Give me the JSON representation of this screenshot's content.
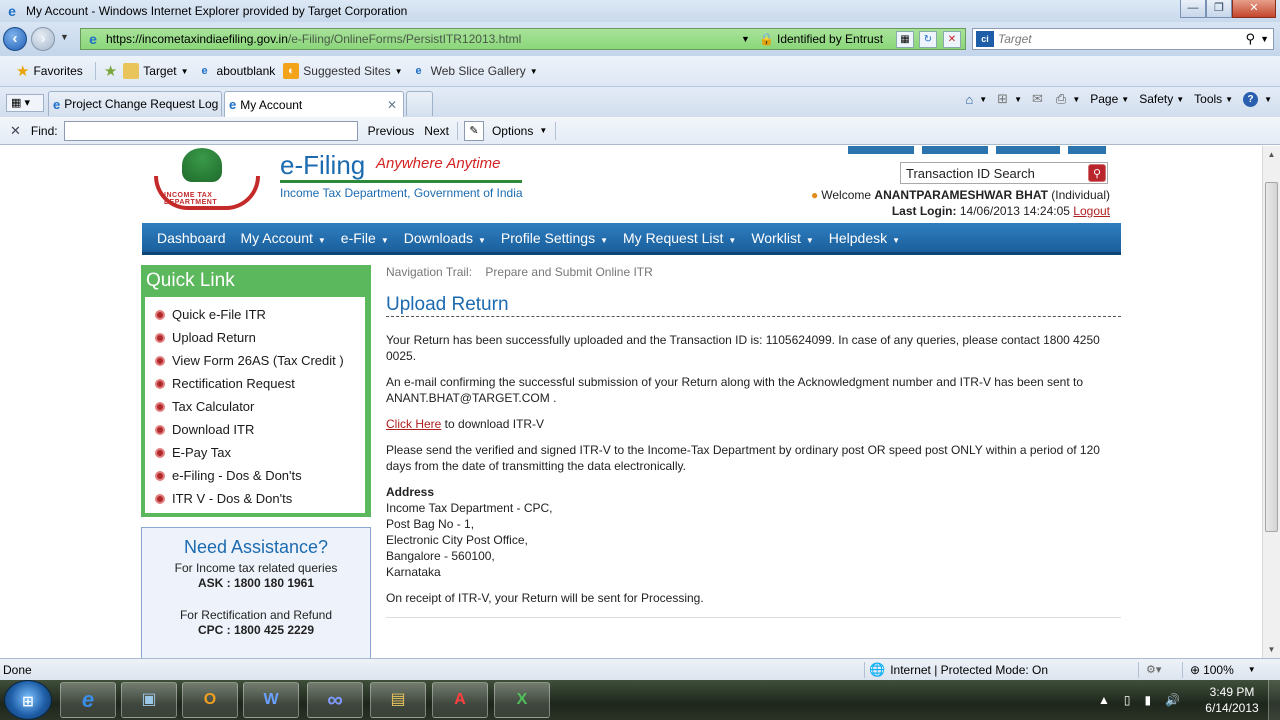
{
  "window": {
    "title": "My Account - Windows Internet Explorer provided by Target Corporation",
    "minimize": "—",
    "restore": "❐",
    "close": "✕"
  },
  "addressbar": {
    "url_host": "https://incometaxindiaefiling.gov.in",
    "url_path": "/e-Filing/OnlineForms/PersistITR12013.html",
    "identity": "Identified by Entrust",
    "search_placeholder": "Target",
    "search_provider_icon": "ci"
  },
  "favorites": {
    "label": "Favorites",
    "items": [
      {
        "label": "Target",
        "icon": "folder-icon",
        "has_menu": true
      },
      {
        "label": "aboutblank",
        "icon": "ie-page-icon",
        "has_menu": false
      },
      {
        "label": "Suggested Sites",
        "icon": "suggested-sites-icon",
        "has_menu": true
      },
      {
        "label": "Web Slice Gallery",
        "icon": "ie-page-icon",
        "has_menu": true
      }
    ]
  },
  "tabs": [
    {
      "label": "Project Change Request Log",
      "active": false
    },
    {
      "label": "My Account",
      "active": true
    }
  ],
  "commandbar": {
    "page": "Page",
    "safety": "Safety",
    "tools": "Tools"
  },
  "findbar": {
    "label": "Find:",
    "value": "",
    "previous": "Previous",
    "next": "Next",
    "options": "Options"
  },
  "site": {
    "brand": "e-Filing",
    "tagline": "Anywhere Anytime",
    "department": "Income Tax Department, Government of India",
    "emblem_text": "INCOME TAX DEPARTMENT",
    "tid_search_placeholder": "Transaction ID Search",
    "welcome_prefix": "Welcome",
    "user_name": "ANANTPARAMESHWAR BHAT",
    "user_type": "(Individual)",
    "last_login_label": "Last Login:",
    "last_login_value": "14/06/2013 14:24:05",
    "logout": "Logout"
  },
  "mainnav": {
    "items": [
      {
        "label": "Dashboard",
        "has_menu": false
      },
      {
        "label": "My Account",
        "has_menu": true
      },
      {
        "label": "e-File",
        "has_menu": true
      },
      {
        "label": "Downloads",
        "has_menu": true
      },
      {
        "label": "Profile Settings",
        "has_menu": true
      },
      {
        "label": "My Request List",
        "has_menu": true
      },
      {
        "label": "Worklist",
        "has_menu": true
      },
      {
        "label": "Helpdesk",
        "has_menu": true
      }
    ]
  },
  "quicklink": {
    "title": "Quick Link",
    "items": [
      "Quick e-File ITR",
      "Upload Return",
      "View Form 26AS (Tax Credit )",
      "Rectification Request",
      "Tax Calculator",
      "Download ITR",
      "E-Pay Tax",
      "e-Filing - Dos & Don'ts",
      "ITR V - Dos & Don'ts"
    ]
  },
  "assistance": {
    "title": "Need Assistance?",
    "line1": "For Income tax related queries",
    "line1_number": "ASK : 1800 180 1961",
    "line2": "For Rectification and Refund",
    "line2_number": "CPC : 1800 425 2229"
  },
  "content": {
    "trail_label": "Navigation Trail:",
    "trail_value": "Prepare and Submit Online ITR",
    "heading": "Upload Return",
    "p1": "Your Return has been successfully uploaded and the Transaction ID is: 1105624099. In case of any queries, please contact 1800 4250 0025.",
    "p2": "An e-mail confirming the successful submission of your Return along with the Acknowledgment number and ITR-V has been sent to ANANT.BHAT@TARGET.COM .",
    "click_here": "Click Here",
    "click_here_rest": " to download ITR-V",
    "p4": "Please send the verified and signed ITR-V to the Income-Tax Department by ordinary post OR speed post ONLY within a period of 120 days from the date of transmitting the data electronically.",
    "address_label": "Address",
    "address_lines": [
      "Income Tax Department - CPC,",
      "Post Bag No - 1,",
      "Electronic City Post Office,",
      "Bangalore - 560100,",
      "Karnataka"
    ],
    "p6": "On receipt of ITR-V, your Return will be sent for Processing."
  },
  "statusbar": {
    "status": "Done",
    "zone": "Internet | Protected Mode: On",
    "zoom": "100%"
  },
  "taskbar": {
    "apps": [
      {
        "name": "internet-explorer",
        "glyph": "e",
        "color": "#3a8ee6"
      },
      {
        "name": "remote-desktop",
        "glyph": "▣",
        "color": "#9cc8e8"
      },
      {
        "name": "outlook",
        "glyph": "O",
        "color": "#f0a020"
      },
      {
        "name": "word",
        "glyph": "W",
        "color": "#2b5fb5"
      },
      {
        "name": "webex",
        "glyph": "∞",
        "color": "#4f6fd8"
      },
      {
        "name": "explorer",
        "glyph": "▤",
        "color": "#e8c45a"
      },
      {
        "name": "acrobat",
        "glyph": "A",
        "color": "#d02020"
      },
      {
        "name": "excel",
        "glyph": "X",
        "color": "#2f8a3a"
      }
    ],
    "time": "3:49 PM",
    "date": "6/14/2013"
  }
}
